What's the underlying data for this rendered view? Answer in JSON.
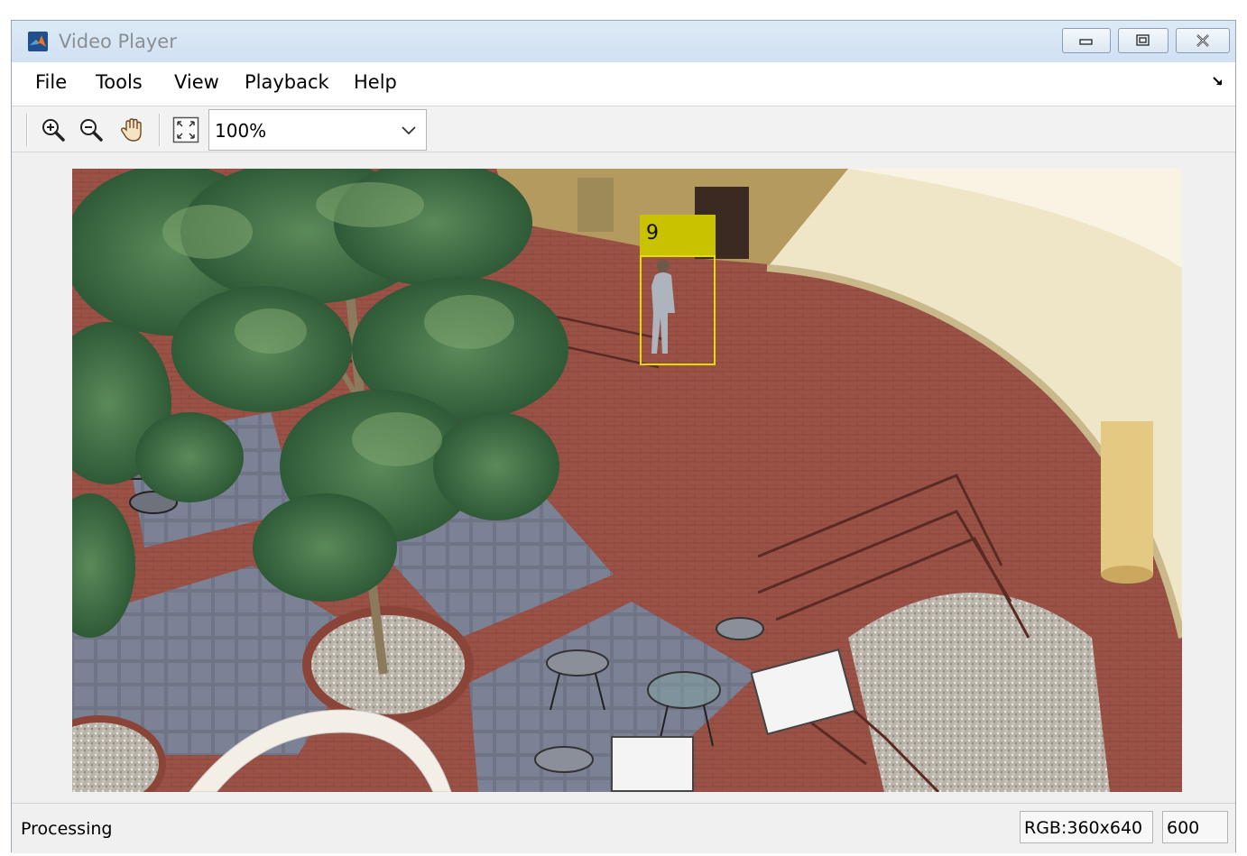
{
  "window": {
    "title": "Video Player",
    "controls": [
      "minimize",
      "maximize",
      "close"
    ]
  },
  "menubar": {
    "items": [
      "File",
      "Tools",
      "View",
      "Playback",
      "Help"
    ]
  },
  "toolbar": {
    "tools": [
      "zoom-in-icon",
      "zoom-out-icon",
      "pan-hand-icon",
      "fit-to-window-icon"
    ],
    "zoom": {
      "value": "100%"
    }
  },
  "video": {
    "track": {
      "id": "9"
    }
  },
  "statusbar": {
    "status": "Processing",
    "format": "RGB:360x640",
    "frame": "600"
  },
  "colors": {
    "track_box": "#e5dd00",
    "track_label_bg": "#c9c200",
    "title_bar": "#d6e4f4"
  }
}
